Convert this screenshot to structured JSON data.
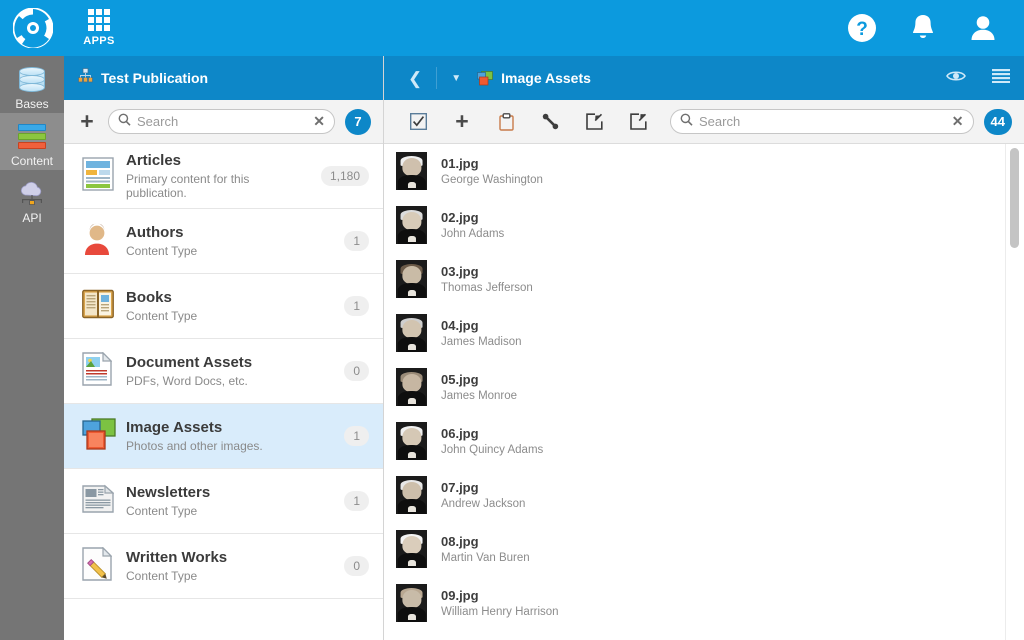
{
  "topbar": {
    "logo_icon": "cms-logo-icon",
    "apps_label": "APPS",
    "apps_icon": "apps-grid-icon",
    "help_icon": "help-circle-icon",
    "notifications_icon": "bell-icon",
    "account_icon": "user-avatar-icon"
  },
  "rail": {
    "items": [
      {
        "label": "Bases",
        "icon": "database-icon",
        "selected": false
      },
      {
        "label": "Content",
        "icon": "content-bars-icon",
        "selected": true
      },
      {
        "label": "API",
        "icon": "cloud-api-icon",
        "selected": false
      }
    ]
  },
  "content_panel": {
    "title": "Test Publication",
    "title_icon": "sitemap-icon",
    "add_icon": "plus-icon",
    "search": {
      "placeholder": "Search",
      "value": "",
      "clear_icon": "clear-x-icon",
      "search_icon": "search-icon"
    },
    "count_badge": "7",
    "types": [
      {
        "name": "Articles",
        "sub": "Primary content for this publication.",
        "count": "1,180",
        "icon": "article-page-icon",
        "selected": false
      },
      {
        "name": "Authors",
        "sub": "Content Type",
        "count": "1",
        "icon": "person-icon",
        "selected": false
      },
      {
        "name": "Books",
        "sub": "Content Type",
        "count": "1",
        "icon": "open-book-icon",
        "selected": false
      },
      {
        "name": "Document Assets",
        "sub": "PDFs, Word Docs, etc.",
        "count": "0",
        "icon": "document-image-icon",
        "selected": false
      },
      {
        "name": "Image Assets",
        "sub": "Photos and other images.",
        "count": "1",
        "icon": "image-stack-icon",
        "selected": true
      },
      {
        "name": "Newsletters",
        "sub": "Content Type",
        "count": "1",
        "icon": "newspaper-icon",
        "selected": false
      },
      {
        "name": "Written Works",
        "sub": "Content Type",
        "count": "0",
        "icon": "pencil-page-icon",
        "selected": false
      }
    ]
  },
  "asset_panel": {
    "title": "Image Assets",
    "title_icon": "image-stack-icon",
    "back_icon": "chevron-left-icon",
    "dropdown_icon": "chevron-down-icon",
    "preview_icon": "eye-icon",
    "menu_icon": "hamburger-menu-icon",
    "toolbar_icons": [
      "select-all-checkbox-icon",
      "add-item-icon",
      "clipboard-icon",
      "link-icon",
      "import-icon",
      "export-icon"
    ],
    "search": {
      "placeholder": "Search",
      "value": "",
      "clear_icon": "clear-x-icon",
      "search_icon": "search-icon"
    },
    "count_badge": "44",
    "assets": [
      {
        "file": "01.jpg",
        "caption": "George Washington",
        "thumb": "portrait-thumbnail"
      },
      {
        "file": "02.jpg",
        "caption": "John Adams",
        "thumb": "portrait-thumbnail"
      },
      {
        "file": "03.jpg",
        "caption": "Thomas Jefferson",
        "thumb": "portrait-thumbnail"
      },
      {
        "file": "04.jpg",
        "caption": "James Madison",
        "thumb": "portrait-thumbnail"
      },
      {
        "file": "05.jpg",
        "caption": "James Monroe",
        "thumb": "portrait-thumbnail"
      },
      {
        "file": "06.jpg",
        "caption": "John Quincy Adams",
        "thumb": "portrait-thumbnail"
      },
      {
        "file": "07.jpg",
        "caption": "Andrew Jackson",
        "thumb": "portrait-thumbnail"
      },
      {
        "file": "08.jpg",
        "caption": "Martin Van Buren",
        "thumb": "portrait-thumbnail"
      },
      {
        "file": "09.jpg",
        "caption": "William Henry Harrison",
        "thumb": "portrait-thumbnail"
      }
    ]
  },
  "colors": {
    "header_blue": "#0c9ade",
    "subheader_blue": "#0d87c8",
    "rail_gray": "#757575",
    "rail_selected_gray": "#8d8d8d",
    "row_selected_blue": "#d9ecfb",
    "badge_blue": "#0d87c8"
  }
}
